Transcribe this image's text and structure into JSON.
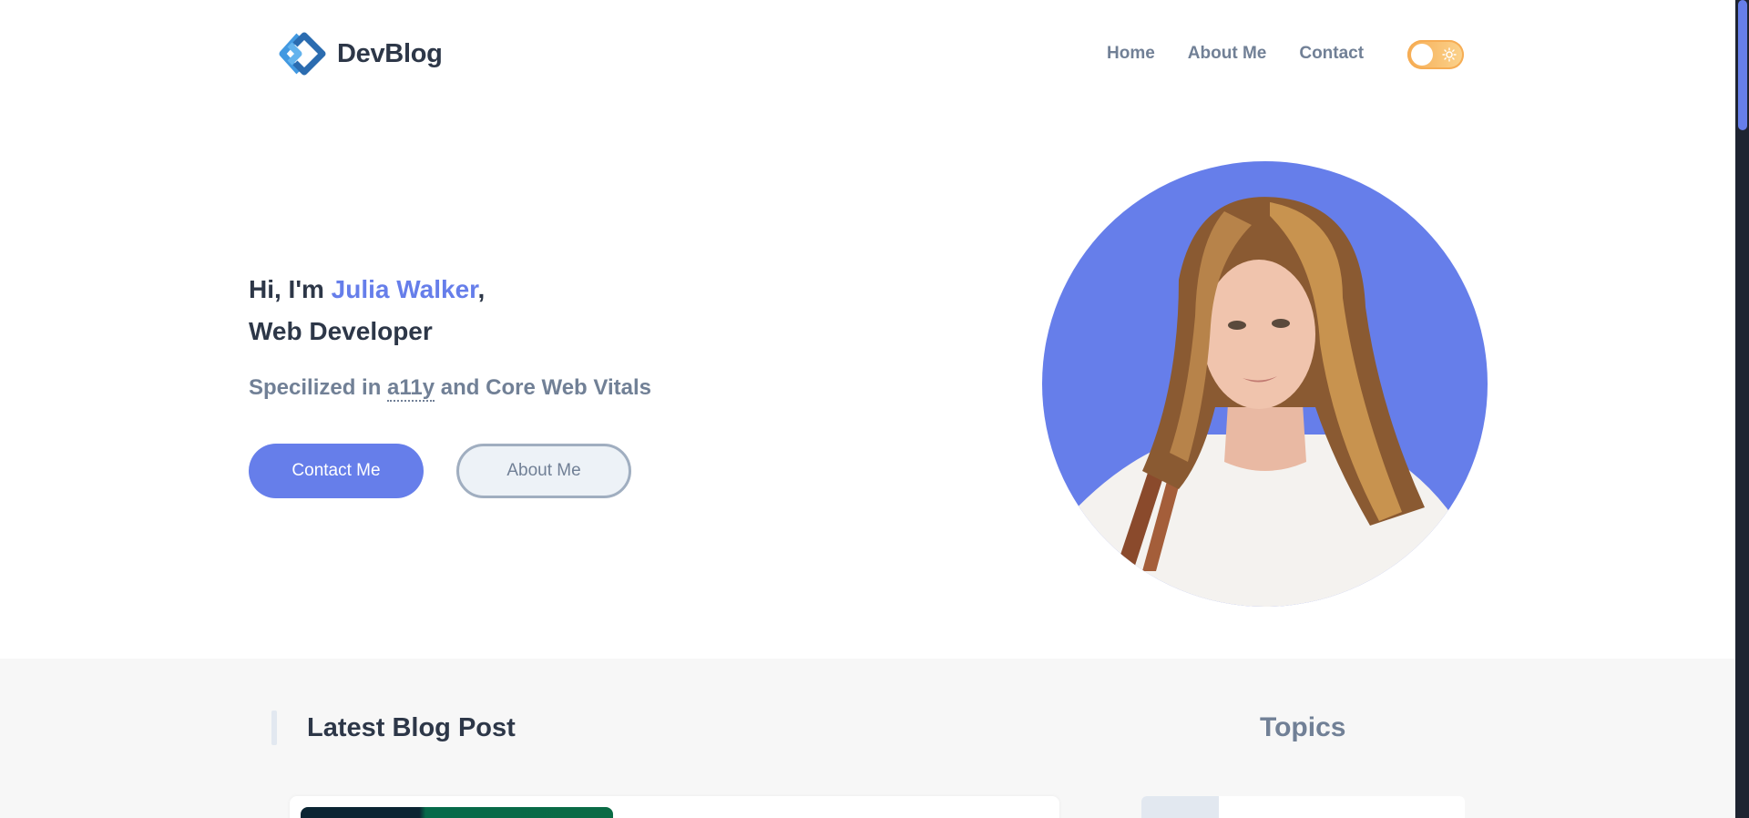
{
  "brand": {
    "name": "DevBlog",
    "colors": {
      "accent": "#667eea",
      "text": "#2d3748",
      "muted": "#718096",
      "toggle": "#f6ad55"
    }
  },
  "nav": {
    "items": [
      {
        "label": "Home"
      },
      {
        "label": "About Me"
      },
      {
        "label": "Contact"
      }
    ],
    "theme_toggle_icon": "sun-icon"
  },
  "hero": {
    "greeting_prefix": "Hi, I'm ",
    "name": "Julia Walker",
    "greeting_suffix": ",",
    "role": "Web Developer",
    "subtitle_prefix": "Specilized in ",
    "subtitle_abbr": "a11y",
    "subtitle_suffix": " and Core Web Vitals",
    "primary_button": "Contact Me",
    "secondary_button": "About Me"
  },
  "blog": {
    "latest_title": "Latest Blog Post",
    "topics_title": "Topics"
  }
}
